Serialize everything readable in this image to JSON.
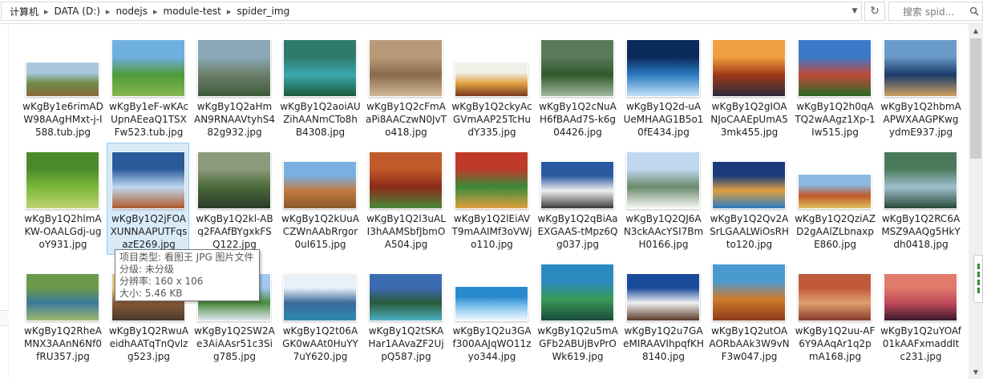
{
  "breadcrumb": [
    "计算机",
    "DATA (D:)",
    "nodejs",
    "module-test",
    "spider_img"
  ],
  "search": {
    "placeholder": "搜索 spid..."
  },
  "files": [
    {
      "name": "wKgBy1e6rimADW98AAgHMxt-j-I588.tub.jpg",
      "colors": [
        "#a9c8e0",
        "#6f8a46",
        "#8a6a3a"
      ],
      "shape": "short"
    },
    {
      "name": "wKgBy1eF-wKAcUpnAEeaQ1TSXFw523.tub.jpg",
      "colors": [
        "#6fb0e0",
        "#4f9a3a",
        "#86b850"
      ],
      "shape": "tall"
    },
    {
      "name": "wKgBy1Q2aHmAN9RNAAVtyhS482g932.jpg",
      "colors": [
        "#8aa8b8",
        "#6b7e6a",
        "#3d5a3a"
      ],
      "shape": "tall"
    },
    {
      "name": "wKgBy1Q2aoiAUZihAANmCTo8hB4308.jpg",
      "colors": [
        "#2f7a6a",
        "#3aa8b0",
        "#1e5a3a"
      ],
      "shape": "tall"
    },
    {
      "name": "wKgBy1Q2cFmAaPi8AACzwN0JvTo418.jpg",
      "colors": [
        "#b89a78",
        "#8a6a4a",
        "#d0b898"
      ],
      "shape": "tall"
    },
    {
      "name": "wKgBy1Q2ckyAcGVmAAP25TcHudY335.jpg",
      "colors": [
        "#f0f0e8",
        "#e0a040",
        "#7a3a20"
      ],
      "shape": "short"
    },
    {
      "name": "wKgBy1Q2cNuAH6fBAAd7S-k6g04426.jpg",
      "colors": [
        "#5a7a5a",
        "#2f5a2a",
        "#a0b8a0"
      ],
      "shape": "tall"
    },
    {
      "name": "wKgBy1Q2d-uAUeMHAAG1B5o10fE434.jpg",
      "colors": [
        "#0a2a5a",
        "#2a7ac0",
        "#c0e0f8"
      ],
      "shape": "tall"
    },
    {
      "name": "wKgBy1Q2gIOANJoCAAEpUmA53mk455.jpg",
      "colors": [
        "#f0a040",
        "#a03a1a",
        "#2a2a3a"
      ],
      "shape": "tall"
    },
    {
      "name": "wKgBy1Q2h0qATQ2wAAgz1Xp-1Iw515.jpg",
      "colors": [
        "#3a7ac8",
        "#c04a3a",
        "#2a6a2a"
      ],
      "shape": "tall"
    },
    {
      "name": "wKgBy1Q2hbmAAPWXAAGPKwgydmE937.jpg",
      "colors": [
        "#6a9ac8",
        "#1a3a6a",
        "#d0a060"
      ],
      "shape": "tall"
    },
    {
      "name": "wKgBy1Q2hlmAKW-OAALGdj-ugoY931.jpg",
      "colors": [
        "#4a8a2a",
        "#7ab83a",
        "#c0d070"
      ],
      "shape": "tall"
    },
    {
      "name": "wKgBy1Q2jFOAXUNNAAPUTFqsazE269.jpg",
      "colors": [
        "#2a5a9a",
        "#c0d8f0",
        "#b05a2a"
      ],
      "shape": "tall"
    },
    {
      "name": "wKgBy1Q2kl-ABq2FAAfBYgxkFSQ122.jpg",
      "colors": [
        "#8a9a7a",
        "#4a6a3a",
        "#2a3a2a"
      ],
      "shape": "tall"
    },
    {
      "name": "wKgBy1Q2kUuACZWnAAbRrgor0uI615.jpg",
      "colors": [
        "#7ab0e0",
        "#c07a40",
        "#8a5a2a"
      ],
      "shape": "normal"
    },
    {
      "name": "wKgBy1Q2l3uALI3hAAMSbfJbmOA504.jpg",
      "colors": [
        "#c05a2a",
        "#8a2a1a",
        "#4a8a3a"
      ],
      "shape": "tall"
    },
    {
      "name": "wKgBy1Q2lEiAVT9mAAIMf3oVWjo110.jpg",
      "colors": [
        "#c03a2a",
        "#3a8a3a",
        "#e0a040"
      ],
      "shape": "tall"
    },
    {
      "name": "wKgBy1Q2qBiAaEXGAAS-tMpz6Qg037.jpg",
      "colors": [
        "#2a5aa0",
        "#f0f0f0",
        "#3a3a3a"
      ],
      "shape": "normal"
    },
    {
      "name": "wKgBy1Q2QJ6AN3ckAAcYSI7BmH0166.jpg",
      "colors": [
        "#c0d8f0",
        "#6a8a6a",
        "#f8f8f8"
      ],
      "shape": "tall"
    },
    {
      "name": "wKgBy1Q2Qv2ASrLGAALWiOsRHto120.jpg",
      "colors": [
        "#1a3a7a",
        "#e0a040",
        "#2a7ac0"
      ],
      "shape": "normal"
    },
    {
      "name": "wKgBy1Q2QziAZD2gAAlZLbnaxpE860.jpg",
      "colors": [
        "#8ab8e0",
        "#c05a2a",
        "#e0c060"
      ],
      "shape": "short"
    },
    {
      "name": "wKgBy1Q2RC6AMSZ9AAQg5HkYdh0418.jpg",
      "colors": [
        "#4a7a5a",
        "#a0c0d0",
        "#2a4a3a"
      ],
      "shape": "tall"
    },
    {
      "name": "wKgBy1Q2RheAMNX3AAnN6Nf0fRU357.jpg",
      "colors": [
        "#6a9a4a",
        "#3a7a9a",
        "#a0b870"
      ],
      "shape": "normal"
    },
    {
      "name": "wKgBy1Q2RwuAeidhAATqTnQvlzg523.jpg",
      "colors": [
        "#e0c080",
        "#8a5a3a",
        "#4a3a2a"
      ],
      "shape": "normal"
    },
    {
      "name": "wKgBy1Q2SW2Ae3AiAAsr51c3Sig785.jpg",
      "colors": [
        "#a0c8f0",
        "#4a8a3a",
        "#e0e8f0"
      ],
      "shape": "normal"
    },
    {
      "name": "wKgBy1Q2t06AGK0wAAt0HuYY7uY620.jpg",
      "colors": [
        "#e8f0f8",
        "#3a6a9a",
        "#2a8ab0"
      ],
      "shape": "normal"
    },
    {
      "name": "wKgBy1Q2tSKAHar1AAvaZF2UjpQ587.jpg",
      "colors": [
        "#3a6ab0",
        "#2a5a3a",
        "#4ab0c0"
      ],
      "shape": "normal"
    },
    {
      "name": "wKgBy1Q2u3GAf300AAJqWO11zyo344.jpg",
      "colors": [
        "#2a8ad0",
        "#8ac8f0",
        "#f0f8ff"
      ],
      "shape": "short"
    },
    {
      "name": "wKgBy1Q2u5mAGFb2ABUjBvPrOWk619.jpg",
      "colors": [
        "#2a8ac0",
        "#3a9a5a",
        "#1a4a3a"
      ],
      "shape": "tall"
    },
    {
      "name": "wKgBy1Q2u7GAeMIRAAVIhpqfKH8140.jpg",
      "colors": [
        "#1a4a9a",
        "#f0f0f0",
        "#5a3a2a"
      ],
      "shape": "normal"
    },
    {
      "name": "wKgBy1Q2utOAAORbAAk3W9vNF3w047.jpg",
      "colors": [
        "#4a9ad0",
        "#d07a2a",
        "#8a3a1a"
      ],
      "shape": "tall"
    },
    {
      "name": "wKgBy1Q2uu-AF6Y9AAqAr1q2pmA168.jpg",
      "colors": [
        "#c05a3a",
        "#e0a070",
        "#8a3a2a"
      ],
      "shape": "normal"
    },
    {
      "name": "wKgBy1Q2uYOAf01kAAFxmaddItc231.jpg",
      "colors": [
        "#e07a6a",
        "#c04a5a",
        "#3a1a2a"
      ],
      "shape": "normal"
    }
  ],
  "selected_index": 12,
  "tooltip": {
    "type": "项目类型: 看图王 JPG 图片文件",
    "rating": "分级: 未分级",
    "resolution": "分辨率: 160 x 106",
    "size": "大小: 5.46 KB"
  },
  "colors": {
    "selection_bg": "#d9ebf9",
    "selection_border": "#99c9ef"
  }
}
